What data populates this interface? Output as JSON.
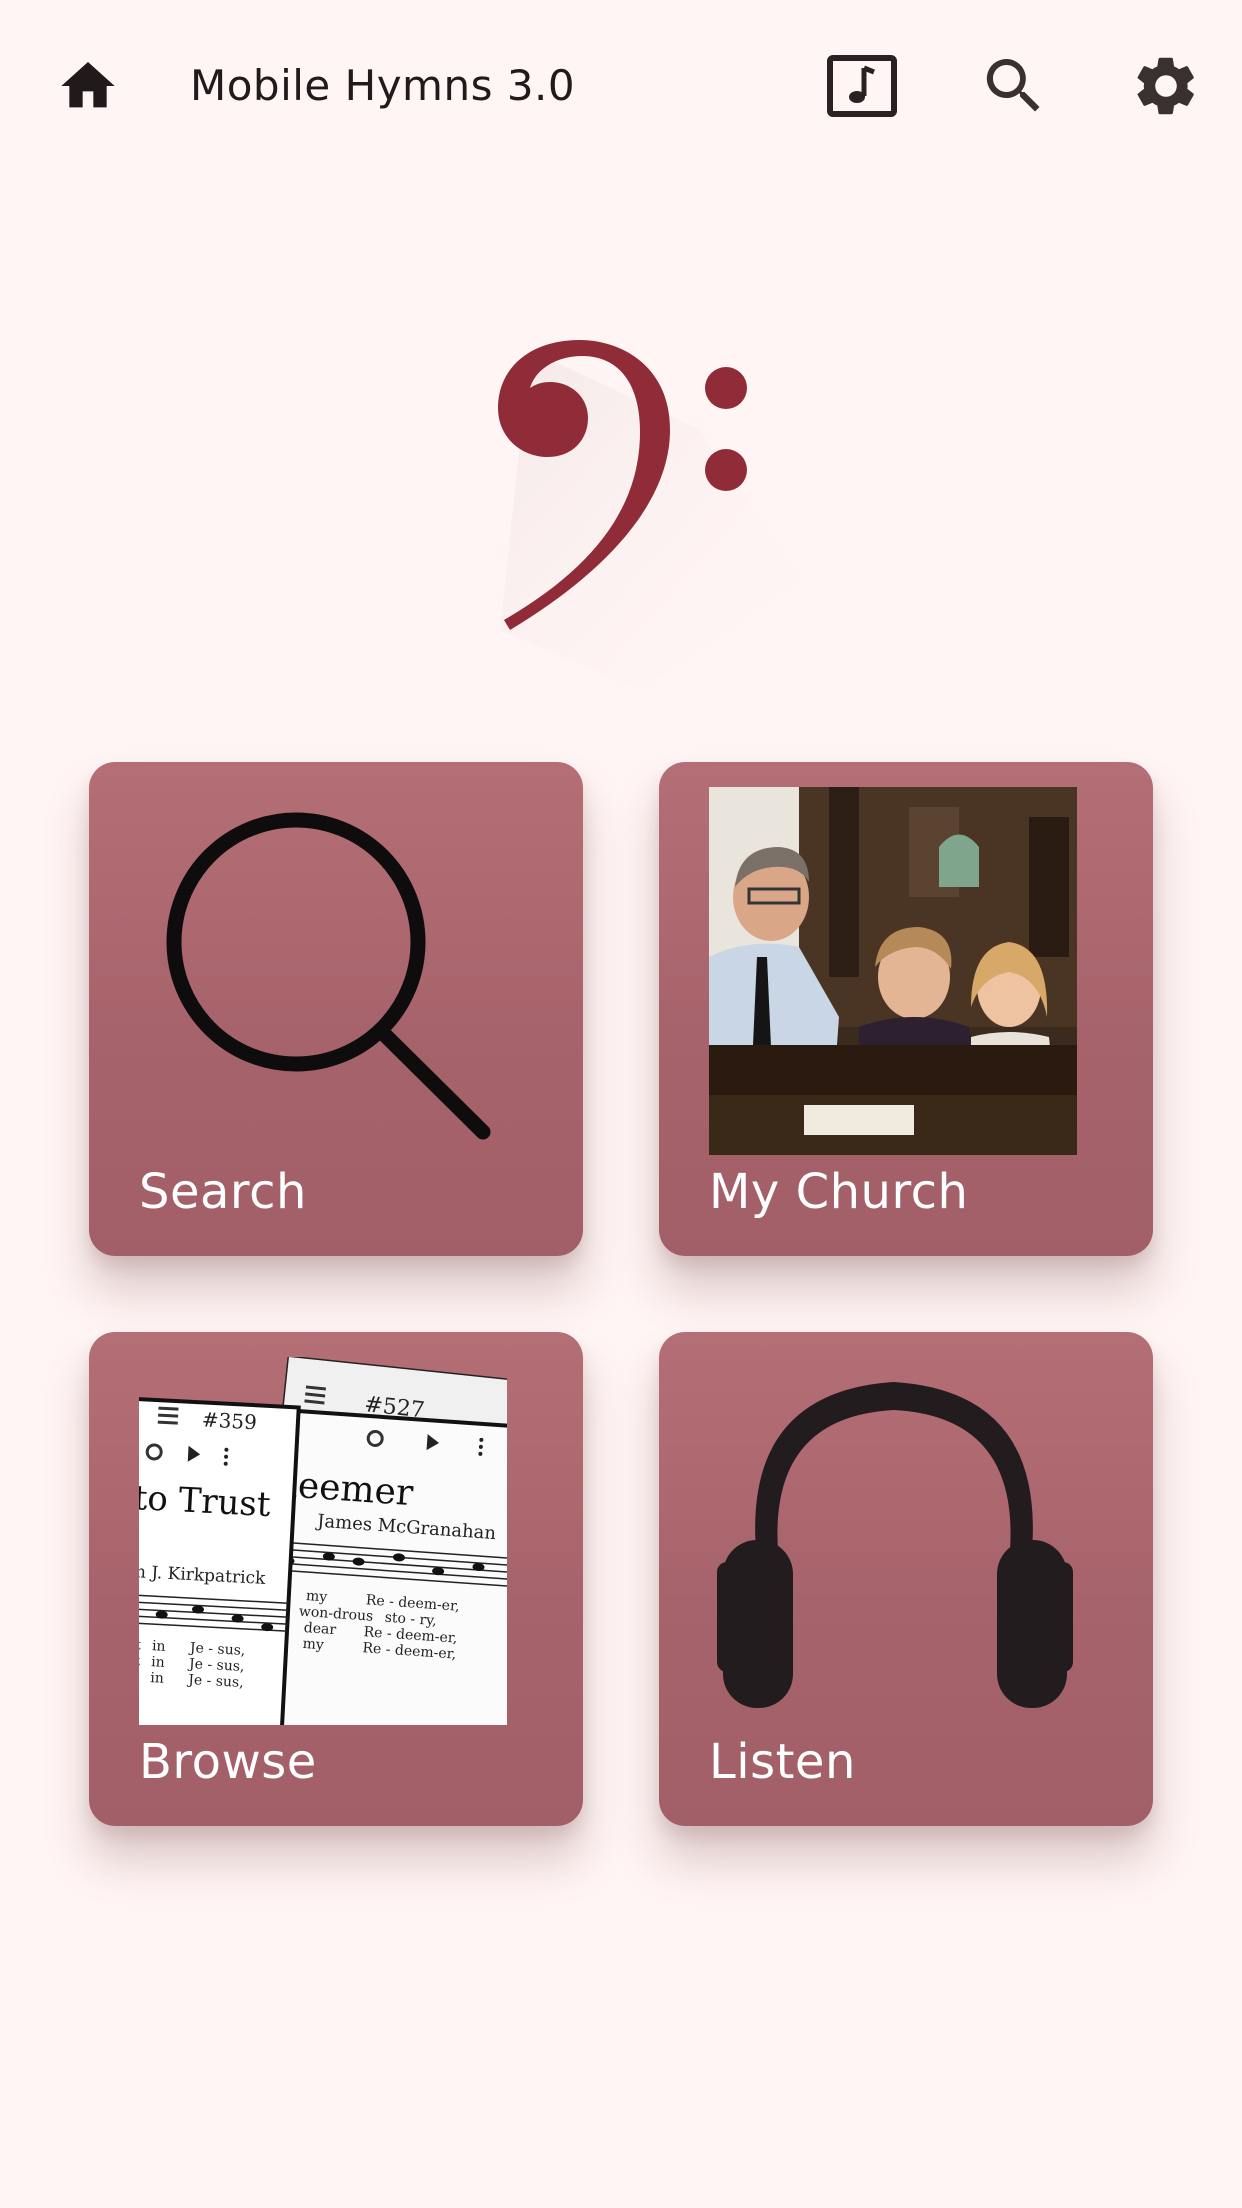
{
  "app": {
    "title": "Mobile Hymns 3.0"
  },
  "icons": {
    "home": "home-icon",
    "music": "music-note-icon",
    "search": "search-icon",
    "settings": "gear-icon",
    "logo": "bass-clef-icon"
  },
  "colors": {
    "tile": "#a7636b",
    "logo": "#8f2c38",
    "background": "#fff5f4",
    "icon": "#201a1a"
  },
  "tiles": [
    {
      "label": "Search",
      "icon": "magnifier-icon"
    },
    {
      "label": "My Church",
      "icon": "church-photo"
    },
    {
      "label": "Browse",
      "icon": "sheet-music-image"
    },
    {
      "label": "Listen",
      "icon": "headphones-icon"
    }
  ],
  "sheets": [
    {
      "number": "#359",
      "title": "to Trust",
      "composer": "m J. Kirkpatrick"
    },
    {
      "number": "#527",
      "title": "edeemer",
      "composer": "James McGranahan"
    }
  ]
}
